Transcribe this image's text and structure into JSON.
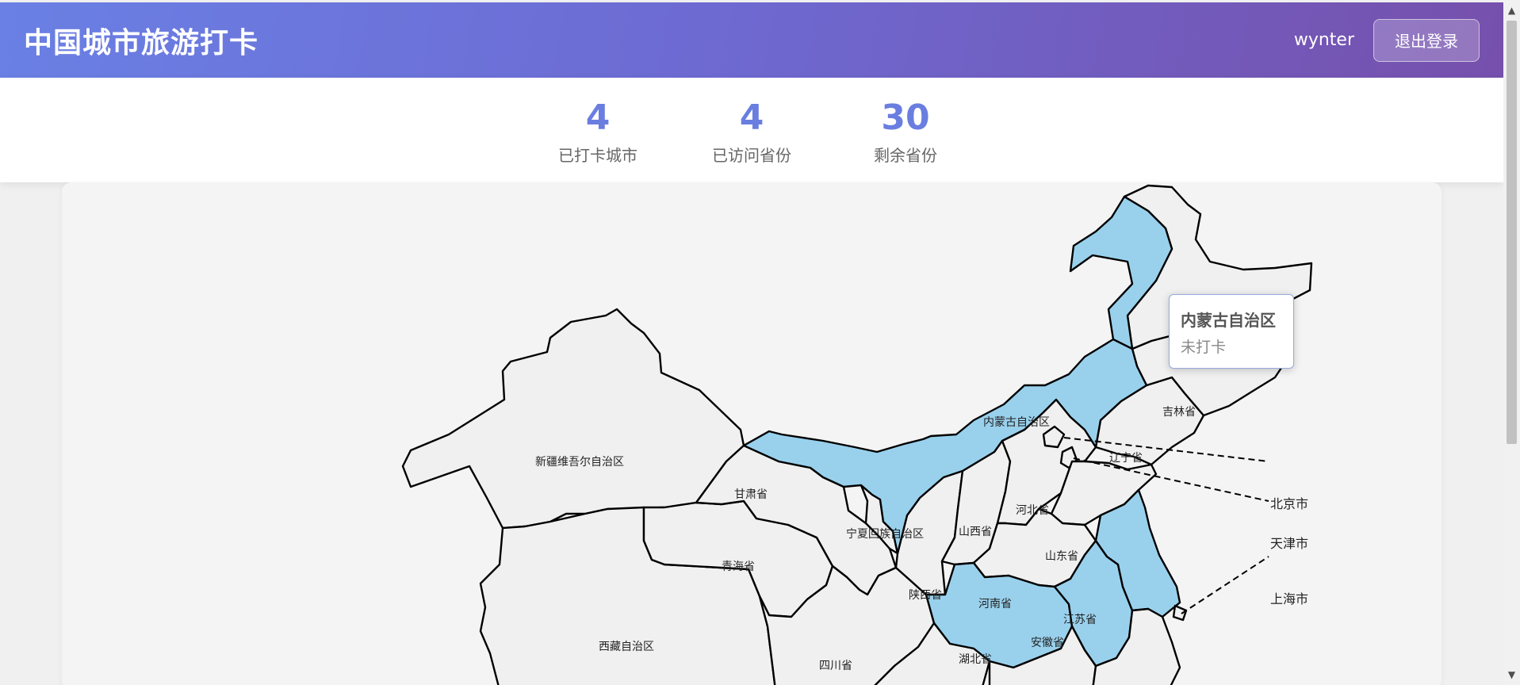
{
  "header": {
    "title": "中国城市旅游打卡",
    "username": "wynter",
    "logout_label": "退出登录"
  },
  "stats": [
    {
      "value": "4",
      "label": "已打卡城市"
    },
    {
      "value": "4",
      "label": "已访问省份"
    },
    {
      "value": "30",
      "label": "剩余省份"
    }
  ],
  "map": {
    "labels": {
      "xinjiang": "新疆维吾尔自治区",
      "xizang": "西藏自治区",
      "qinghai": "青海省",
      "gansu": "甘肃省",
      "ningxia": "宁夏回族自治区",
      "sichuan": "四川省",
      "shaanxi": "陕西省",
      "shanxi": "山西省",
      "neimenggu": "内蒙古自治区",
      "jilin": "吉林省",
      "liaoning": "辽宁省",
      "hebei": "河北省",
      "shandong": "山东省",
      "henan": "河南省",
      "hubei": "湖北省",
      "anhui": "安徽省",
      "jiangsu": "江苏省",
      "beijing": "北京市",
      "tianjin": "天津市",
      "shanghai": "上海市"
    },
    "tooltip": {
      "title": "内蒙古自治区",
      "status": "未打卡"
    },
    "colors": {
      "visited": "#99d1ed",
      "unvisited": "#f0f0f0",
      "border": "#000000"
    }
  }
}
